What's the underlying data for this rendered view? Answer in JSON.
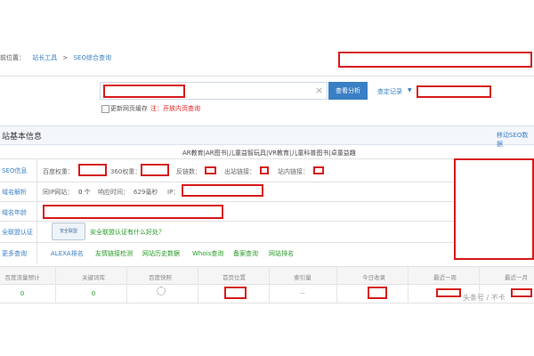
{
  "breadcrumb": {
    "prefix": "前位置：",
    "item1": "站长工具",
    "sep": ">",
    "item2": "SEO综合查询"
  },
  "search": {
    "button": "查看分析",
    "history": "查定记录",
    "checkbox_label": "更新网页缓存",
    "note": "注：开放内页查询"
  },
  "section": {
    "title": "站基本信息",
    "mobile_link": "移动SEO数据"
  },
  "site_title": "AR教育|AR图书|儿童益智玩具|VR教育|儿童科普图书|卓童益趣",
  "seo": {
    "label": "SEO信息",
    "baidu_weight": "百度权重：",
    "so360_weight": "360权重：",
    "backlinks": "反链数：",
    "outlinks": "出站链接：",
    "inlinks": "站内链接："
  },
  "dns": {
    "label": "域名解析",
    "same_ip": "同IP网站：",
    "same_ip_count": "0 个",
    "response_time": "响应时间：",
    "response_value": "629毫秒",
    "ip": "IP："
  },
  "age": {
    "label": "域名年龄"
  },
  "alliance": {
    "label": "全联盟认证",
    "badge_text": "安全联盟",
    "question": "安全联盟认证有什么好处？"
  },
  "more": {
    "label": "更多查询",
    "links": [
      "ALEXA排名",
      "友情链接检测",
      "网站历史数据",
      "Whois查询",
      "备案查询",
      "网站排名"
    ]
  },
  "table": {
    "headers": [
      "百度流量预计",
      "关键词库",
      "百度快照",
      "首页位置",
      "索引量",
      "今日收录",
      "最近一周",
      "最近一月"
    ],
    "values": [
      "0",
      "0",
      "",
      "",
      "--",
      "",
      "",
      ""
    ]
  },
  "watermark": "头条号 / 不卡"
}
